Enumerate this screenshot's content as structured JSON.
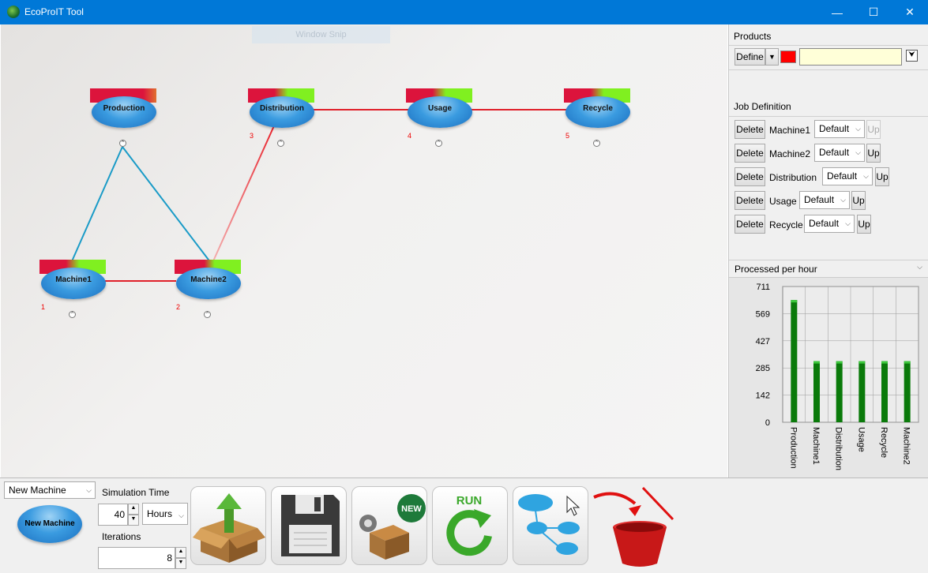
{
  "window": {
    "title": "EcoProIT Tool",
    "minimize": "—",
    "maximize": "☐",
    "close": "✕"
  },
  "canvas": {
    "snip_label": "Window Snip",
    "nodes": [
      {
        "id": "production",
        "label": "Production",
        "number": ""
      },
      {
        "id": "distribution",
        "label": "Distribution",
        "number": "3"
      },
      {
        "id": "usage",
        "label": "Usage",
        "number": "4"
      },
      {
        "id": "recycle",
        "label": "Recycle",
        "number": "5"
      },
      {
        "id": "machine1",
        "label": "Machine1",
        "number": "1"
      },
      {
        "id": "machine2",
        "label": "Machine2",
        "number": "2"
      }
    ]
  },
  "products": {
    "title": "Products",
    "define_label": "Define",
    "color": "#ff0000",
    "name_value": ""
  },
  "job_definition": {
    "title": "Job Definition",
    "delete_label": "Delete",
    "up_label": "Up",
    "rows": [
      {
        "name": "Machine1",
        "option": "Default"
      },
      {
        "name": "Machine2",
        "option": "Default"
      },
      {
        "name": "Distribution",
        "option": "Default"
      },
      {
        "name": "Usage",
        "option": "Default"
      },
      {
        "name": "Recycle",
        "option": "Default"
      }
    ]
  },
  "stats_selector": {
    "value": "Processed per hour"
  },
  "chart_data": {
    "type": "bar",
    "categories": [
      "Production",
      "Machine1",
      "Distribution",
      "Usage",
      "Recycle",
      "Machine2"
    ],
    "values": [
      640,
      320,
      320,
      320,
      320,
      320
    ],
    "yticks": [
      "711",
      "569",
      "427",
      "285",
      "142",
      "0"
    ],
    "ylim": [
      0,
      711
    ],
    "grid": true,
    "bar_color": "#0a7a0a"
  },
  "bottom": {
    "machine_type": "New Machine",
    "new_machine_label": "New Machine",
    "sim_time_label": "Simulation Time",
    "sim_time_value": "40",
    "sim_time_unit": "Hours",
    "iterations_label": "Iterations",
    "iterations_value": "8",
    "new_badge": "NEW",
    "run_label": "RUN"
  }
}
